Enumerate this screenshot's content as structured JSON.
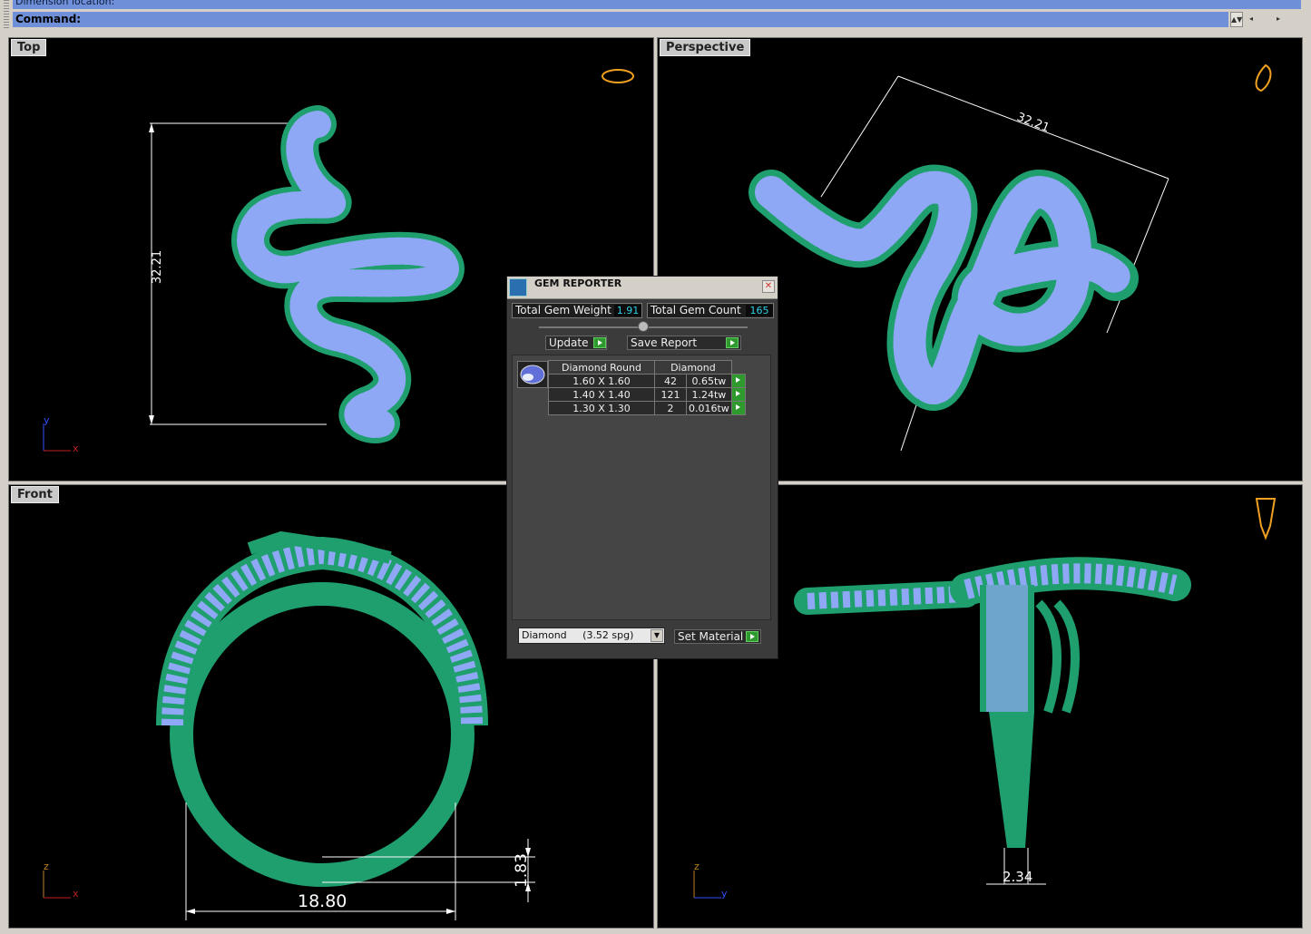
{
  "command_bar": {
    "line1": "Dimension location:",
    "line2": "Command:"
  },
  "viewports": {
    "top": {
      "label": "Top",
      "dimension": "32.21",
      "axis_y": "y",
      "axis_x": "x"
    },
    "perspective": {
      "label": "Perspective",
      "dimension": "32.21"
    },
    "front": {
      "label": "Front",
      "dimension_width": "18.80",
      "dimension_thickness": "1.83",
      "axis_z": "z",
      "axis_x": "x"
    },
    "right": {
      "dimension_width": "2.34",
      "axis_z": "z",
      "axis_y": "y"
    }
  },
  "gem_reporter": {
    "title": "GEM REPORTER",
    "total_weight_label": "Total Gem Weight",
    "total_weight_value": "1.91",
    "total_count_label": "Total Gem Count",
    "total_count_value": "165",
    "update_label": "Update",
    "save_report_label": "Save Report",
    "table_header_cut": "Diamond Round",
    "table_header_material": "Diamond",
    "rows": [
      {
        "size": "1.60 X 1.60",
        "count": "42",
        "weight": "0.65tw"
      },
      {
        "size": "1.40 X 1.40",
        "count": "121",
        "weight": "1.24tw"
      },
      {
        "size": "1.30 X 1.30",
        "count": "2",
        "weight": "0.016tw"
      }
    ],
    "material_select": "Diamond     (3.52 spg)",
    "set_material_label": "Set Material"
  },
  "colors": {
    "metal": "#1f9e6e",
    "gem": "#8fa8f5",
    "dimension": "#ffffff",
    "gizmo": "#f0a020"
  }
}
